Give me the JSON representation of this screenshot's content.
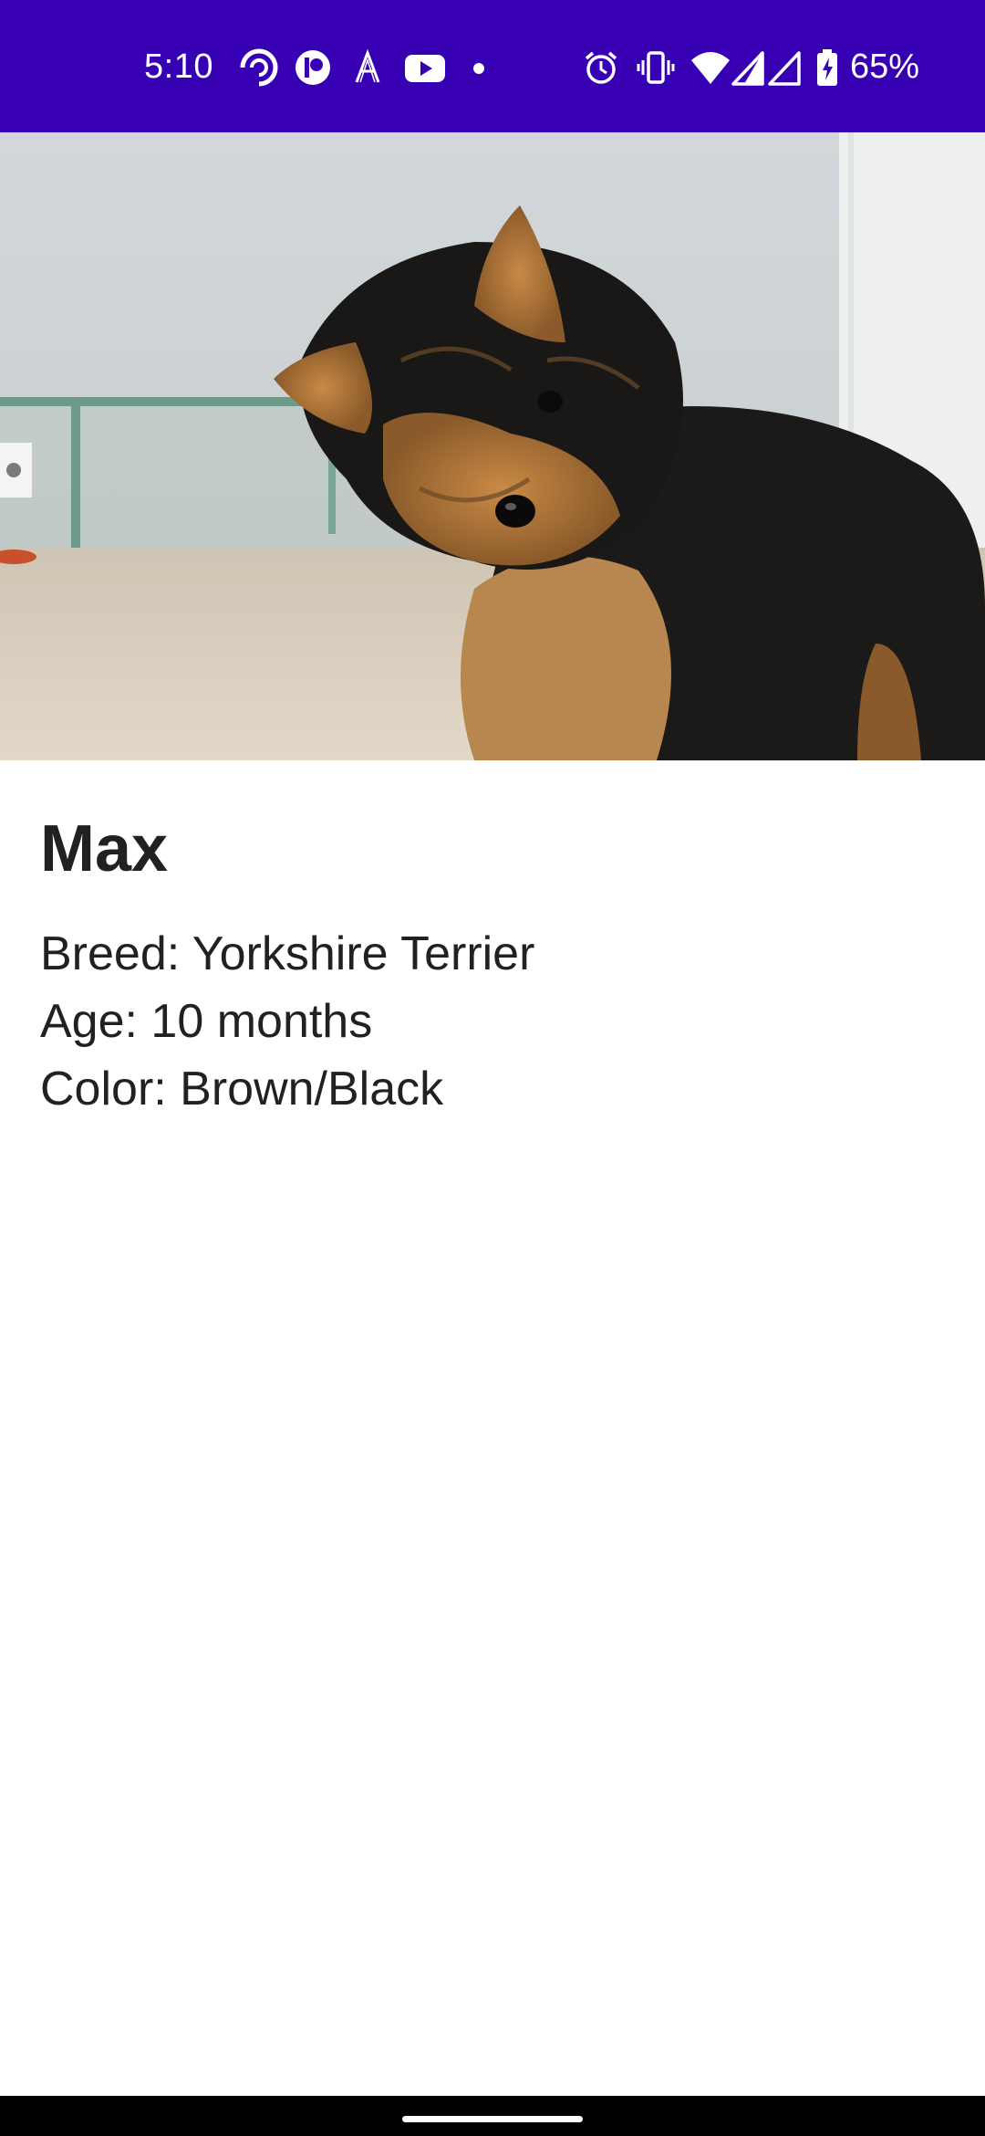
{
  "status_bar": {
    "time": "5:10",
    "battery": "65%",
    "background_color": "#3700b3",
    "left_icons": [
      "pocket-casts-icon",
      "patreon-icon",
      "font-a-icon",
      "youtube-icon",
      "notification-dot-icon"
    ],
    "right_icons": [
      "alarm-icon",
      "vibrate-icon",
      "wifi-icon",
      "signal-icon",
      "signal-icon",
      "battery-charging-icon"
    ]
  },
  "pet": {
    "image": "yorkshire-terrier-photo",
    "name": "Max",
    "breed": "Breed: Yorkshire Terrier",
    "age": "Age: 10 months",
    "color": "Color: Brown/Black"
  }
}
